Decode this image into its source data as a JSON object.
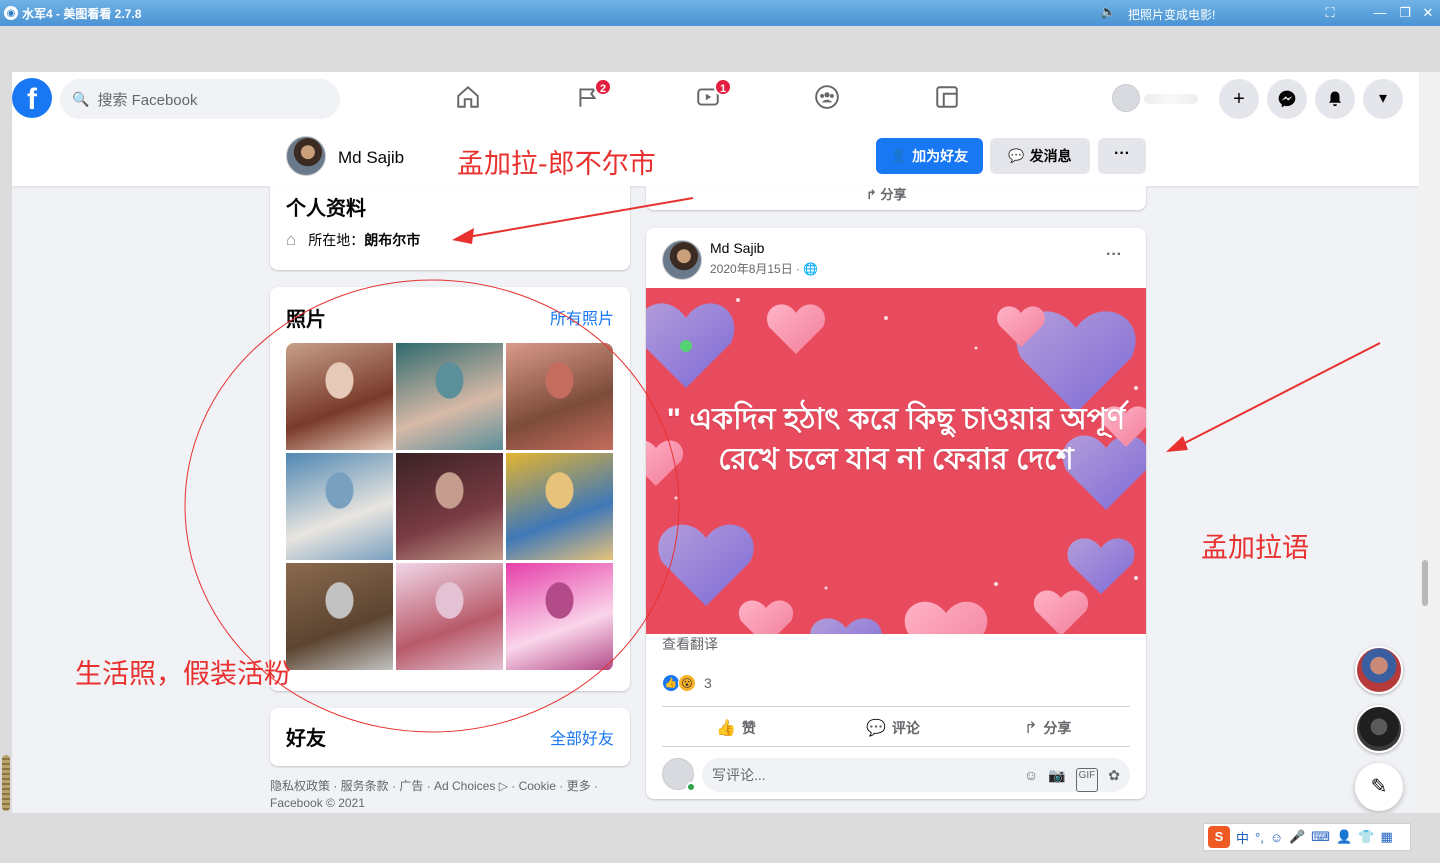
{
  "window": {
    "title": "水军4 - 美图看看 2.7.8",
    "banner": "把照片变成电影!",
    "icon": "app-icon"
  },
  "facebook_nav": {
    "logo": "f",
    "search_placeholder": "搜索 Facebook",
    "tabs": [
      {
        "name": "home-icon",
        "badge": ""
      },
      {
        "name": "pages-flag-icon",
        "badge": "2"
      },
      {
        "name": "watch-icon",
        "badge": "1"
      },
      {
        "name": "groups-icon",
        "badge": ""
      },
      {
        "name": "gaming-icon",
        "badge": ""
      }
    ],
    "buttons": [
      "+",
      "messenger-icon",
      "notifications-icon",
      "▾"
    ]
  },
  "profile_header": {
    "name": "Md Sajib",
    "add_friend": "加为好友",
    "message": "发消息",
    "more": "···"
  },
  "intro": {
    "title": "个人资料",
    "location_label": "所在地：",
    "location_value": "朗布尔市"
  },
  "photos": {
    "title": "照片",
    "link": "所有照片",
    "items": [
      {
        "colors": [
          "#c7a08a",
          "#7a3a2a",
          "#e7c9b8"
        ]
      },
      {
        "colors": [
          "#2e6a6e",
          "#d7b9a7",
          "#5b8f9a"
        ]
      },
      {
        "colors": [
          "#d99a8a",
          "#7d4b3a",
          "#c46d5e"
        ]
      },
      {
        "colors": [
          "#4f87b3",
          "#e9e5df",
          "#7aa0c0"
        ]
      },
      {
        "colors": [
          "#3a2224",
          "#7a3b44",
          "#c59d8e"
        ]
      },
      {
        "colors": [
          "#e4b431",
          "#3f78b8",
          "#e7c27b"
        ]
      },
      {
        "colors": [
          "#8a6a4e",
          "#5c4430",
          "#c2c2c2"
        ]
      },
      {
        "colors": [
          "#f1d6e7",
          "#b85a6a",
          "#e4c2d3"
        ]
      },
      {
        "colors": [
          "#e53ea9",
          "#fad5ea",
          "#b24b88"
        ]
      }
    ]
  },
  "friends": {
    "title": "好友",
    "link": "全部好友"
  },
  "footer": {
    "text": "隐私权政策 · 服务条款 · 广告 · Ad Choices ▷ · Cookie · 更多 · Facebook © 2021"
  },
  "post": {
    "author": "Md Sajib",
    "date": "2020年8月15日 ·",
    "quote": "\" একদিন হঠাৎ করে কিছু চাওয়ার অপূর্ণ রেখে চলে যাব না ফেরার দেশে",
    "translate": "查看翻译",
    "reaction_count": "3",
    "like": "赞",
    "comment": "评论",
    "share": "分享",
    "comment_placeholder": "写评论...",
    "share_top": "分享"
  },
  "annotations": {
    "location_note": "孟加拉-郎不尔市",
    "photos_note": "生活照，假装活粉",
    "language_note": "孟加拉语"
  },
  "colors": {
    "fb_blue": "#1877f2",
    "annotation_red": "#e8312f",
    "post_bg": "#e94b5e"
  },
  "ime": {
    "label": "中"
  }
}
